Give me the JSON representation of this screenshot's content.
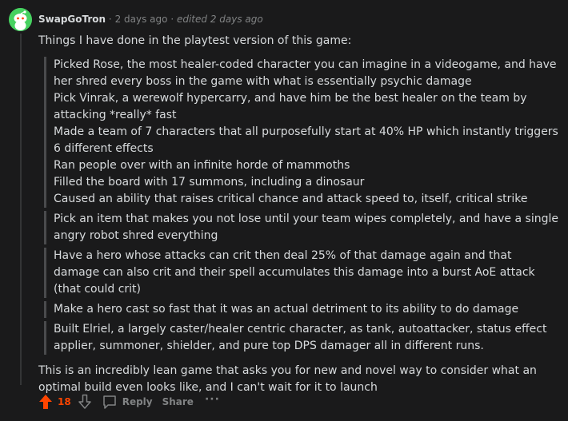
{
  "comment": {
    "author": "SwapGoTron",
    "separator": "·",
    "age": "2 days ago",
    "edited": "edited 2 days ago",
    "intro": "Things I have done in the playtest version of this game:",
    "quotes": [
      [
        "Picked Rose, the most healer-coded character you can imagine in a videogame, and have her shred every boss in the game with what is essentially psychic damage",
        "Pick Vinrak, a werewolf hypercarry, and have him be the best healer on the team by attacking *really* fast",
        "Made a team of 7 characters that all purposefully start at 40% HP which instantly triggers 6 different effects",
        "Ran people over with an infinite horde of mammoths",
        "Filled the board with 17 summons, including a dinosaur",
        "Caused an ability that raises critical chance and attack speed to, itself, critical strike"
      ],
      [
        "Pick an item that makes you not lose until your team wipes completely, and have a single angry robot shred everything"
      ],
      [
        "Have a hero whose attacks can crit then deal 25% of that damage again and that damage can also crit and their spell accumulates this damage into a burst AoE attack (that could crit)"
      ],
      [
        "Make a hero cast so fast that it was an actual detriment to its ability to do damage"
      ],
      [
        "Built Elriel, a largely caster/healer centric character, as tank, autoattacker, status effect applier, summoner, shielder, and pure top DPS damager all in different runs."
      ]
    ],
    "outro": "This is an incredibly lean game that asks you for new and novel way to consider what an optimal build even looks like, and I can't wait for it to launch"
  },
  "actions": {
    "upvote_icon": "arrow-up-icon",
    "score": "18",
    "downvote_icon": "arrow-down-icon",
    "reply_icon": "speech-bubble-icon",
    "reply_label": "Reply",
    "share_label": "Share",
    "more_label": "···"
  },
  "colors": {
    "background": "#1a1a1b",
    "text": "#d7dadc",
    "muted": "#818384",
    "upvote": "#ff4500",
    "avatar": "#46d160",
    "quote_border": "#4a4b4d"
  }
}
